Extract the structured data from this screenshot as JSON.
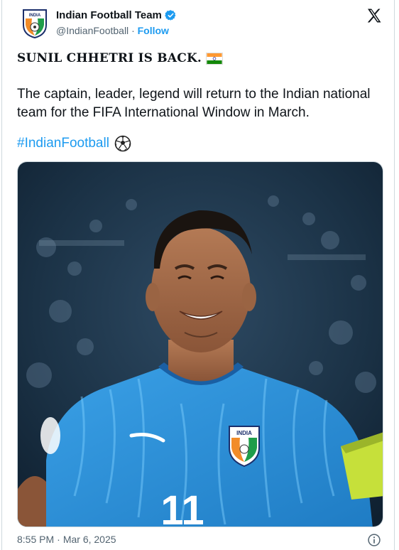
{
  "tweet": {
    "display_name": "Indian Football Team",
    "handle": "@IndianFootball",
    "separator": "·",
    "follow_label": "Follow",
    "headline": "SUNIL CHHETRI IS BACK.",
    "body": "The captain, leader, legend will return to the Indian national team for the FIFA International Window in March.",
    "hashtag": "#IndianFootball",
    "time": "8:55 PM",
    "date": "Mar 6, 2025",
    "time_separator": "·",
    "avatar_text": "INDIA",
    "jersey_number": "11",
    "badge_text": "INDIA"
  },
  "icons": {
    "verified": "verified-badge-icon",
    "platform": "x-logo-icon",
    "flag": "india-flag-icon",
    "ball": "soccer-ball-icon",
    "info": "info-icon"
  },
  "colors": {
    "accent": "#1d9bf0",
    "text": "#0f1419",
    "muted": "#536471",
    "border": "#cfd9de",
    "jersey": "#2f8fd6"
  }
}
